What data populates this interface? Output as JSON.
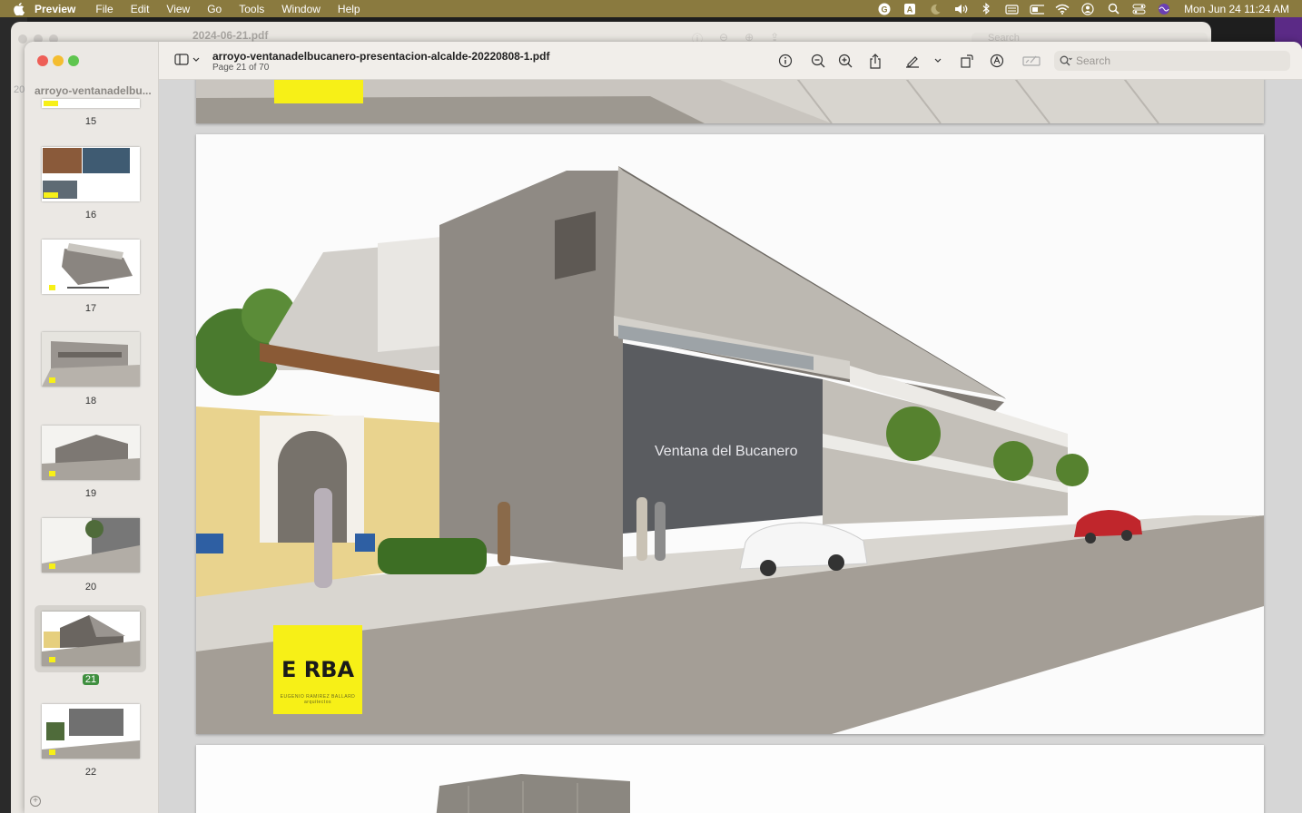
{
  "menubar": {
    "app_name": "Preview",
    "items": [
      "File",
      "Edit",
      "View",
      "Go",
      "Tools",
      "Window",
      "Help"
    ],
    "clock": "Mon Jun 24  11:24 AM"
  },
  "background_window": {
    "title": "2024-06-21.pdf",
    "side_label": "20",
    "search_placeholder": "Search"
  },
  "window": {
    "title": "arroyo-ventanadelbucanero-presentacion-alcalde-20220808-1.pdf",
    "subtitle": "Page 21 of 70",
    "sidebar_title": "arroyo-ventanadelbu...",
    "search_placeholder": "Search"
  },
  "thumbnails": [
    {
      "page": "15"
    },
    {
      "page": "16"
    },
    {
      "page": "17"
    },
    {
      "page": "18"
    },
    {
      "page": "19"
    },
    {
      "page": "20"
    },
    {
      "page": "21",
      "selected": true
    },
    {
      "page": "22"
    }
  ],
  "page_content": {
    "sign_text": "Ventana del Bucanero",
    "logo_text": "E RBA",
    "logo_tagline": "EUGENIO RAMIREZ BALLARD arquitectos"
  },
  "colors": {
    "menubar": "#8a7a3f",
    "logo_yellow": "#f7f017",
    "selected_badge": "#3f8f3f"
  }
}
